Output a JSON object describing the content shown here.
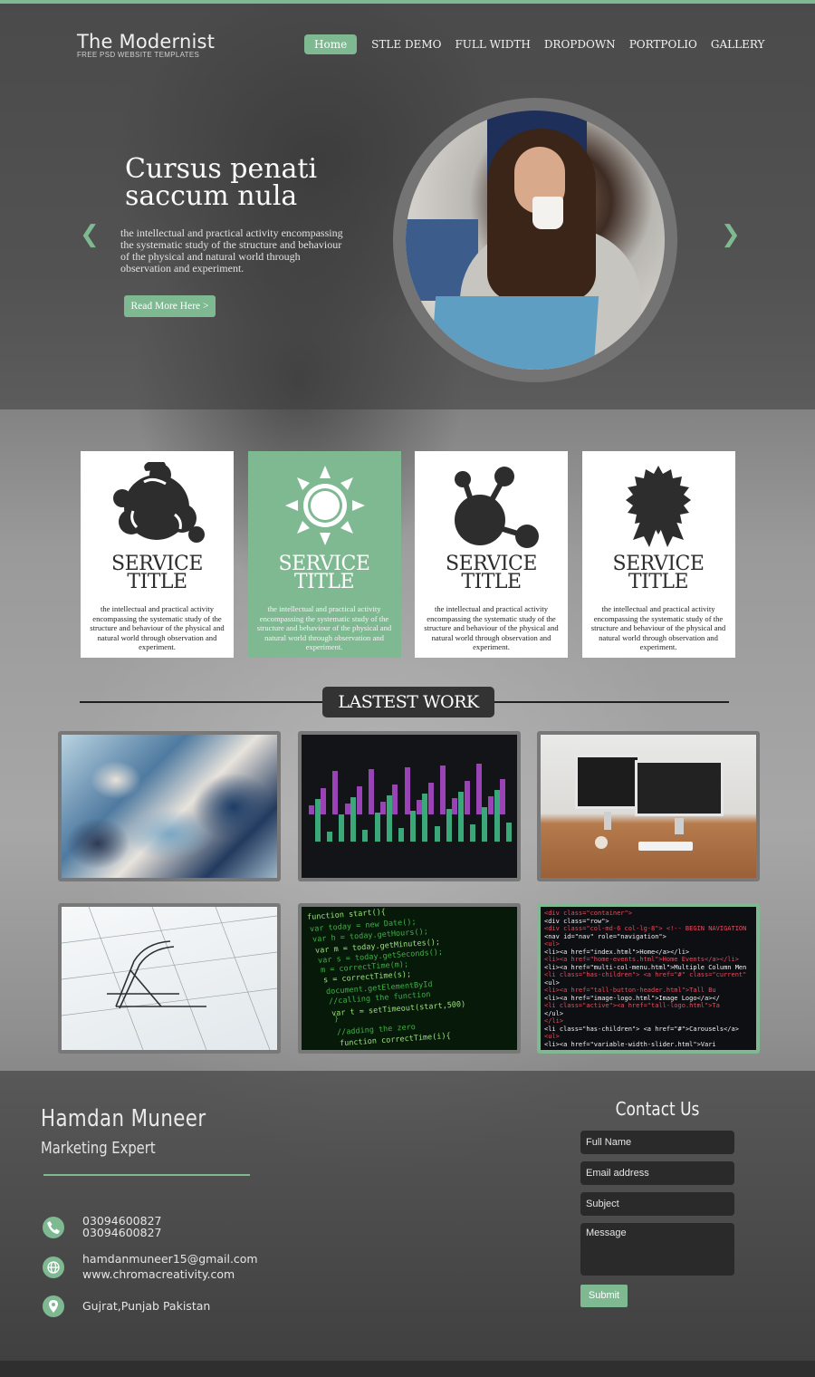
{
  "brand": {
    "title": "The Modernist",
    "subtitle": "FREE PSD WEBSITE TEMPLATES"
  },
  "nav": [
    {
      "label": "Home",
      "active": true
    },
    {
      "label": "STLE DEMO"
    },
    {
      "label": "FULL WIDTH"
    },
    {
      "label": "DROPDOWN"
    },
    {
      "label": "PORTPOLIO"
    },
    {
      "label": "GALLERY"
    }
  ],
  "hero": {
    "title": "Cursus penati saccum nula",
    "text": "the intellectual and practical activity encompassing the systematic study of the structure and behaviour of the physical and natural world through observation and experiment.",
    "button": "Read More Here >",
    "prev_icon": "chevron-left-icon",
    "next_icon": "chevron-right-icon"
  },
  "services": [
    {
      "icon": "blob-icon",
      "title": "SERVICE\nTITLE",
      "text": "the intellectual and practical activity encompassing the systematic study of the structure and behaviour of the physical and natural world through observation and experiment."
    },
    {
      "icon": "sun-icon",
      "title": "SERVICE\nTITLE",
      "text": "the intellectual and practical activity encompassing the systematic study of the structure and behaviour of the physical and natural world through observation and experiment.",
      "highlight": true
    },
    {
      "icon": "molecule-icon",
      "title": "SERVICE\nTITLE",
      "text": "the intellectual and practical activity encompassing the systematic study of the structure and behaviour of the physical and natural world through observation and experiment."
    },
    {
      "icon": "award-ribbon-icon",
      "title": "SERVICE\nTITLE",
      "text": "the intellectual and practical activity encompassing the systematic study of the structure and behaviour of the physical and natural world through observation and experiment."
    }
  ],
  "work": {
    "heading": "LASTEST WORK",
    "items": [
      {
        "name": "fluid-art-thumbnail"
      },
      {
        "name": "audio-editor-thumbnail"
      },
      {
        "name": "desk-computers-thumbnail"
      },
      {
        "name": "architecture-sketch-thumbnail"
      },
      {
        "name": "javascript-code-thumbnail"
      },
      {
        "name": "html-code-thumbnail",
        "active": true
      }
    ],
    "code_js": [
      "function start(){",
      "  var today = new Date();",
      "  var h = today.getHours();",
      "  var m = today.getMinutes();",
      "  var s = today.getSeconds();",
      "  m = correctTime(m);",
      "  s = correctTime(s);",
      "  document.getElementById",
      "  //calling the function",
      "  var t = setTimeout(start,500)",
      "}",
      "//adding the zero",
      "function correctTime(i){"
    ],
    "code_html": [
      "<div class=\"container\">",
      "  <div class=\"row\">",
      "    <div class=\"col-md-6 col-lg-8\"> <!-- BEGIN NAVIGATION",
      "      <nav id=\"nav\" role=\"navigation\">",
      "        <ul>",
      "          <li><a href=\"index.html\">Home</a></li>",
      "          <li><a href=\"home-events.html\">Home Events</a></li>",
      "          <li><a href=\"multi-col-menu.html\">Multiple Column Men",
      "          <li class=\"has-children\"> <a href=\"#\" class=\"current\"",
      "            <ul>",
      "              <li><a href=\"tall-button-header.html\">Tall Bu",
      "              <li><a href=\"image-logo.html\">Image Logo</a></",
      "              <li class=\"active\"><a href=\"tall-logo.html\">Ta",
      "            </ul>",
      "          </li>",
      "          <li class=\"has-children\"> <a href=\"#\">Carousels</a>",
      "            <ul>",
      "              <li><a href=\"variable-width-slider.html\">Vari"
    ]
  },
  "profile": {
    "name": "Hamdan Muneer",
    "role": "Marketing Expert",
    "phone1": "03094600827",
    "phone2": "03094600827",
    "email": "hamdanmuneer15@gmail.com",
    "website": "www.chromacreativity.com",
    "location": "Gujrat,Punjab Pakistan",
    "phone_icon": "phone-icon",
    "web_icon": "globe-icon",
    "location_icon": "location-pin-icon"
  },
  "contact": {
    "title": "Contact Us",
    "full_name_placeholder": "Full Name",
    "email_placeholder": "Email address",
    "subject_placeholder": "Subject",
    "message_placeholder": "Message",
    "submit": "Submit"
  },
  "colors": {
    "accent": "#7fb992",
    "dark": "#2d2d2d"
  }
}
